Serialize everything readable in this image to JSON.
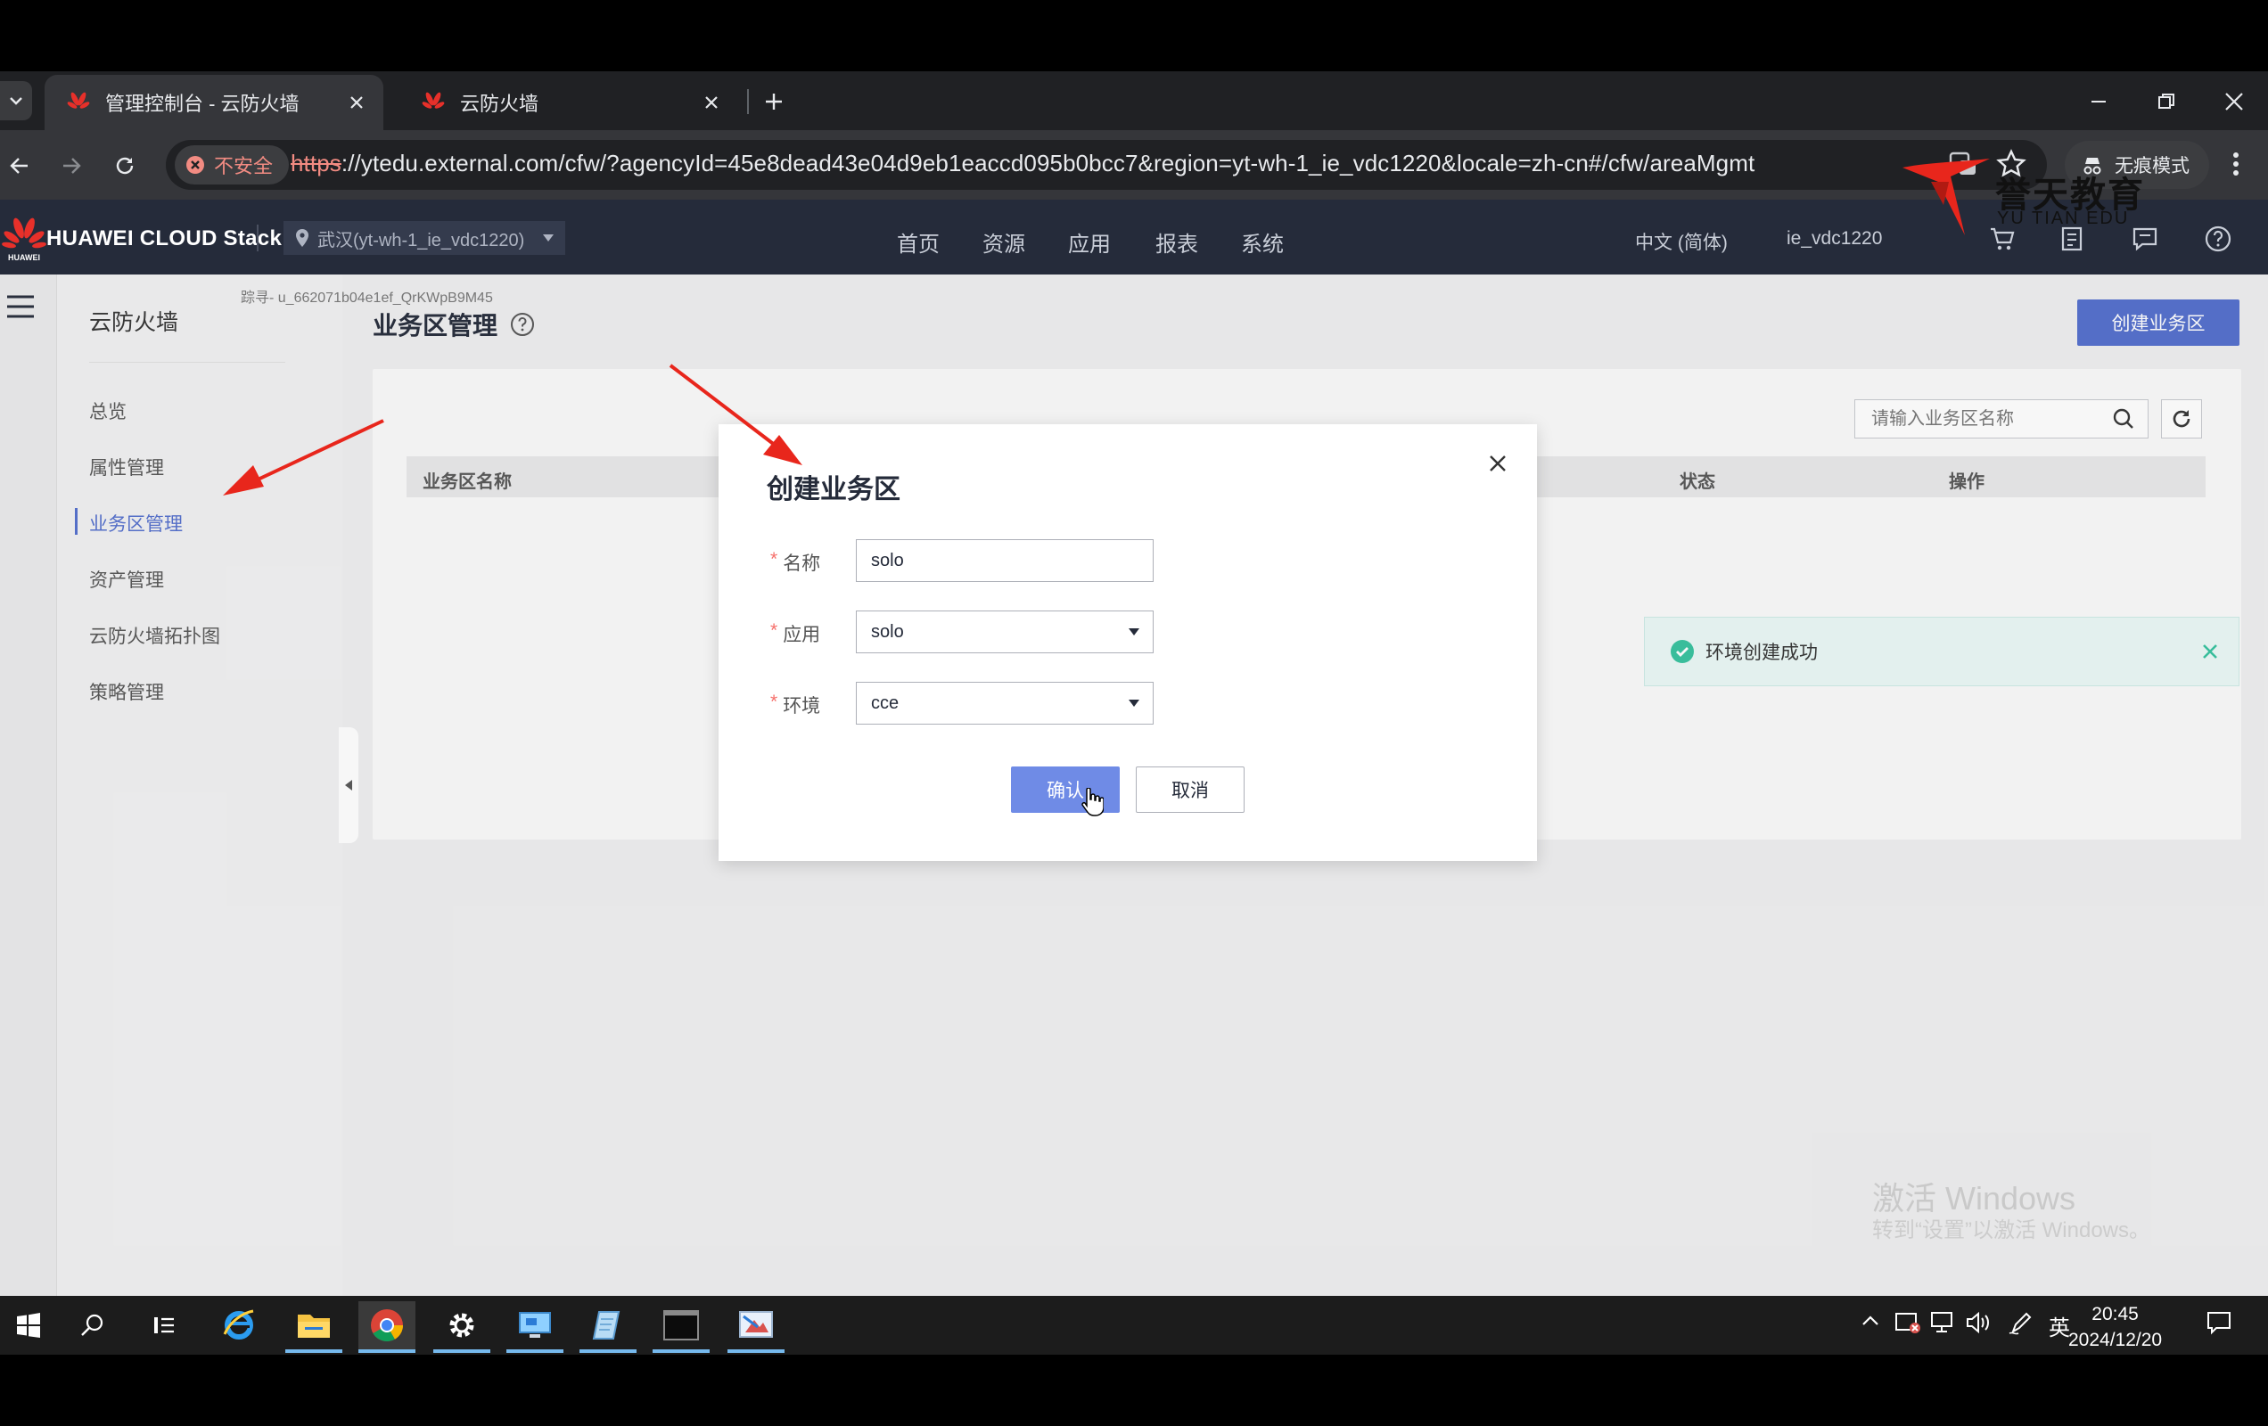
{
  "browser": {
    "tabs": [
      {
        "title": "管理控制台 - 云防火墙",
        "active": true
      },
      {
        "title": "云防火墙",
        "active": false
      }
    ],
    "security_label": "不安全",
    "url_scheme": "https",
    "url_rest": "://ytedu.external.com/cfw/?agencyId=45e8dead43e04d9eb1eaccd095b0bcc7&region=yt-wh-1_ie_vdc1220&locale=zh-cn#/cfw/areaMgmt",
    "incognito_label": "无痕模式"
  },
  "watermark": {
    "brand": "誉天教育",
    "brand_en": "YU TIAN EDU"
  },
  "header": {
    "brand": "HUAWEI CLOUD Stack",
    "logo_text": "HUAWEI",
    "region": "武汉(yt-wh-1_ie_vdc1220)",
    "nav": [
      "首页",
      "资源",
      "应用",
      "报表",
      "系统"
    ],
    "language": "中文 (简体)",
    "account": "ie_vdc1220"
  },
  "sidebar": {
    "title": "云防火墙",
    "items": [
      "总览",
      "属性管理",
      "业务区管理",
      "资产管理",
      "云防火墙拓扑图",
      "策略管理"
    ],
    "active_index": 2
  },
  "page": {
    "trace": "踪寻- u_662071b04e1ef_QrKWpB9M45",
    "title": "业务区管理",
    "create_button": "创建业务区",
    "search_placeholder": "请输入业务区名称",
    "table_headers": [
      "业务区名称",
      "状态",
      "操作"
    ]
  },
  "toast": {
    "message": "环境创建成功",
    "status_color": "#36c29e"
  },
  "modal": {
    "title": "创建业务区",
    "fields": [
      {
        "label": "名称",
        "value": "solo",
        "type": "text"
      },
      {
        "label": "应用",
        "value": "solo",
        "type": "select"
      },
      {
        "label": "环境",
        "value": "cce",
        "type": "select"
      }
    ],
    "confirm": "确认",
    "cancel": "取消"
  },
  "os": {
    "activation_title": "激活 Windows",
    "activation_sub": "转到“设置”以激活 Windows。",
    "ime": "英",
    "time": "20:45",
    "date": "2024/12/20"
  },
  "colors": {
    "primary": "#526ecc",
    "header_bg": "#252b3a",
    "required": "#f66f6a",
    "annotation_arrow": "#e8261c"
  }
}
